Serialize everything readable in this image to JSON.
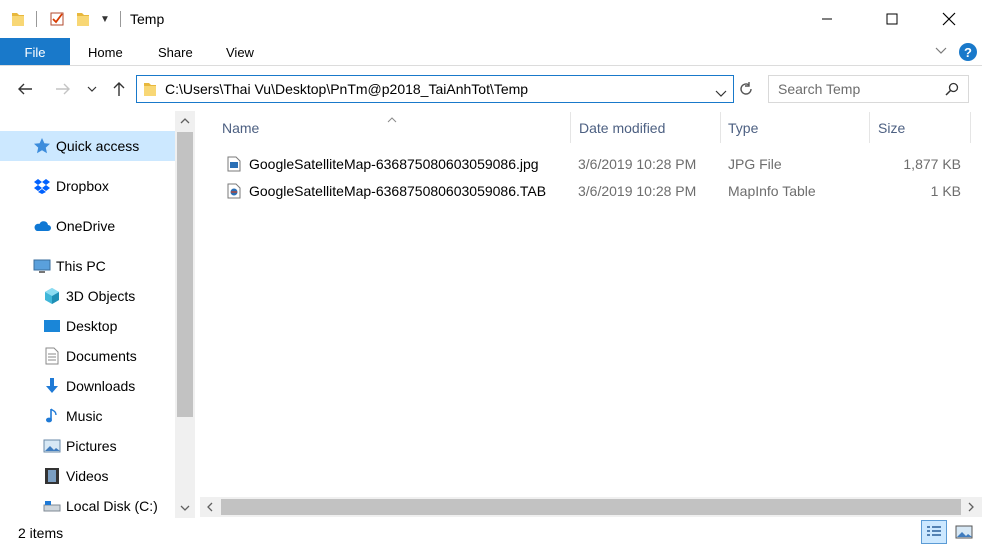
{
  "window": {
    "title": "Temp",
    "controls": {
      "minimize": "—",
      "maximize": "☐",
      "close": "✕"
    }
  },
  "ribbon": {
    "tabs": [
      "File",
      "Home",
      "Share",
      "View"
    ]
  },
  "address": {
    "path": "C:\\Users\\Thai Vu\\Desktop\\PnTm@p2018_TaiAnhTot\\Temp"
  },
  "search": {
    "placeholder": "Search Temp"
  },
  "navigation": {
    "items": [
      {
        "label": "Quick access",
        "icon": "star-icon"
      },
      {
        "label": "Dropbox",
        "icon": "dropbox-icon"
      },
      {
        "label": "OneDrive",
        "icon": "cloud-icon"
      },
      {
        "label": "This PC",
        "icon": "computer-icon"
      },
      {
        "label": "3D Objects",
        "icon": "cube-icon"
      },
      {
        "label": "Desktop",
        "icon": "desktop-icon"
      },
      {
        "label": "Documents",
        "icon": "document-icon"
      },
      {
        "label": "Downloads",
        "icon": "download-icon"
      },
      {
        "label": "Music",
        "icon": "music-icon"
      },
      {
        "label": "Pictures",
        "icon": "pictures-icon"
      },
      {
        "label": "Videos",
        "icon": "videos-icon"
      },
      {
        "label": "Local Disk (C:)",
        "icon": "disk-icon"
      }
    ]
  },
  "columns": {
    "name": "Name",
    "date": "Date modified",
    "type": "Type",
    "size": "Size"
  },
  "files": [
    {
      "name": "GoogleSatelliteMap-636875080603059086.jpg",
      "date": "3/6/2019 10:28 PM",
      "type": "JPG File",
      "size": "1,877 KB",
      "icon": "image-file-icon"
    },
    {
      "name": "GoogleSatelliteMap-636875080603059086.TAB",
      "date": "3/6/2019 10:28 PM",
      "type": "MapInfo Table",
      "size": "1 KB",
      "icon": "mapinfo-file-icon"
    }
  ],
  "status": {
    "item_count": "2 items"
  },
  "colors": {
    "accent": "#1979ca",
    "selection": "#cce8ff",
    "header_text": "#4d6082"
  }
}
